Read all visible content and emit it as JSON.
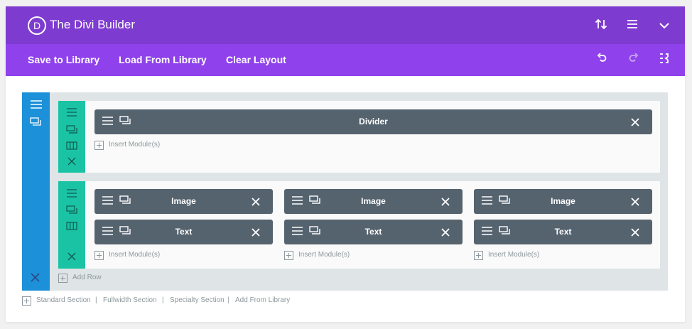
{
  "header": {
    "logo_letter": "D",
    "title": "The Divi Builder",
    "icons": [
      "sort-icon",
      "menu-icon",
      "collapse-icon"
    ]
  },
  "toolbar": {
    "save_to_library": "Save to Library",
    "load_from_library": "Load From Library",
    "clear_layout": "Clear Layout",
    "icons": [
      "undo-icon",
      "redo-icon",
      "history-icon"
    ]
  },
  "rows": [
    {
      "columns": [
        {
          "modules": [
            "Divider"
          ],
          "insert_label": "Insert Module(s)"
        }
      ]
    },
    {
      "columns": [
        {
          "modules": [
            "Image",
            "Text"
          ],
          "insert_label": "Insert Module(s)"
        },
        {
          "modules": [
            "Image",
            "Text"
          ],
          "insert_label": "Insert Module(s)"
        },
        {
          "modules": [
            "Image",
            "Text"
          ],
          "insert_label": "Insert Module(s)"
        }
      ]
    }
  ],
  "add_row_label": "Add Row",
  "bottom_links": {
    "standard_section": "Standard Section",
    "fullwidth_section": "Fullwidth Section",
    "specialty_section": "Specialty Section",
    "add_from_library": "Add From Library",
    "separator": "|"
  },
  "colors": {
    "header": "#7e3bd0",
    "toolbar": "#8f42ec",
    "section_bar": "#1c90d8",
    "row_bar": "#1bc3a5",
    "module": "#55636f"
  }
}
